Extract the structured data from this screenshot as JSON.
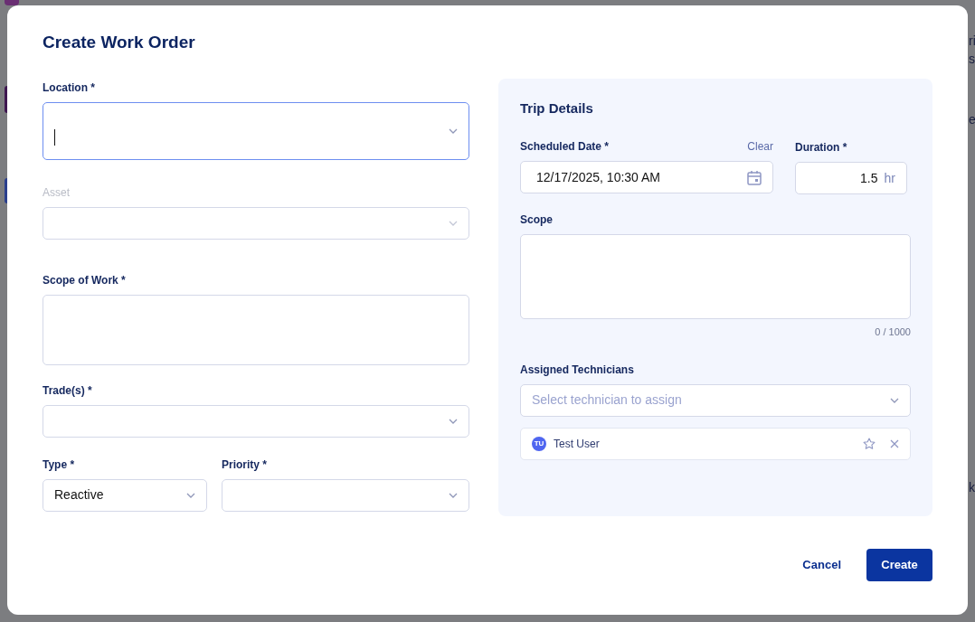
{
  "background": {
    "edge_fragments": [
      "ri",
      "s",
      "e",
      "k"
    ]
  },
  "dialog": {
    "title": "Create Work Order"
  },
  "location": {
    "label": "Location *",
    "focused": true
  },
  "asset": {
    "label": "Asset",
    "disabled": true
  },
  "scope_of_work": {
    "label": "Scope of Work *"
  },
  "trades": {
    "label": "Trade(s) *"
  },
  "type": {
    "label": "Type *",
    "value": "Reactive"
  },
  "priority": {
    "label": "Priority *"
  },
  "trip_details": {
    "title": "Trip Details",
    "scheduled_date": {
      "label": "Scheduled Date *",
      "clear": "Clear",
      "value": "12/17/2025, 10:30 AM"
    },
    "duration": {
      "label": "Duration *",
      "value": "1.5",
      "unit": "hr"
    },
    "scope": {
      "label": "Scope",
      "counter": "0 / 1000"
    },
    "technicians": {
      "label": "Assigned Technicians",
      "placeholder": "Select technician to assign",
      "assigned": [
        {
          "initials": "TU",
          "name": "Test User",
          "starred": false
        }
      ]
    }
  },
  "buttons": {
    "cancel": "Cancel",
    "create": "Create"
  }
}
